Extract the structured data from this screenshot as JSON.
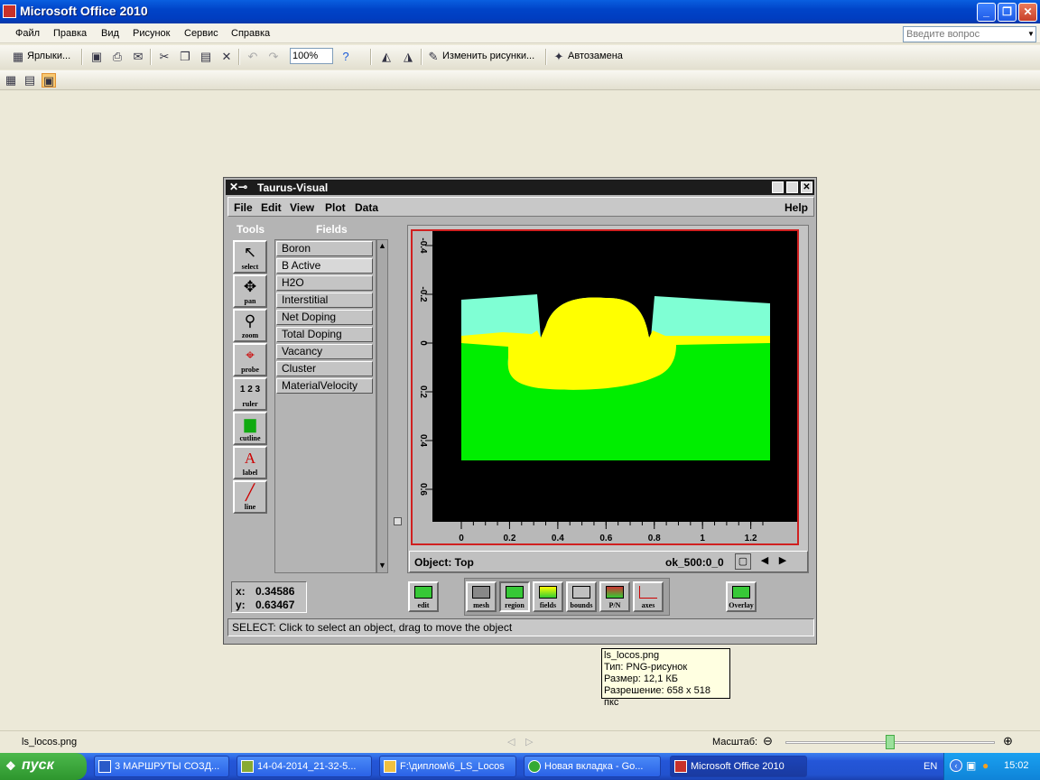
{
  "window": {
    "title": "Microsoft Office 2010"
  },
  "menu": [
    "Файл",
    "Правка",
    "Вид",
    "Рисунок",
    "Сервис",
    "Справка"
  ],
  "ask_placeholder": "Введите вопрос",
  "toolbar": {
    "shortcuts_label": "Ярлыки...",
    "zoom": "100%",
    "edit_pictures_label": "Изменить рисунки...",
    "autocorrect_label": "Автозамена"
  },
  "taurus": {
    "title": "Taurus-Visual",
    "menu": [
      "File",
      "Edit",
      "View",
      "Plot",
      "Data"
    ],
    "help": "Help",
    "tools_header": "Tools",
    "fields_header": "Fields",
    "tools": [
      "select",
      "pan",
      "zoom",
      "probe",
      "ruler",
      "cutline",
      "label",
      "line"
    ],
    "fields": [
      "Boron",
      "B Active",
      "H2O",
      "Interstitial",
      "Net Doping",
      "Total Doping",
      "Vacancy",
      "Cluster",
      "MaterialVelocity"
    ],
    "coords": {
      "x_label": "x:",
      "x": "0.34586",
      "y_label": "y:",
      "y": "0.63467"
    },
    "object_label": "Object: Top",
    "object_name": "ok_500:0_0",
    "bottom_buttons": [
      "edit",
      "mesh",
      "region",
      "fields",
      "bounds",
      "P/N",
      "axes",
      "Overlay"
    ],
    "status": "SELECT: Click to select an object, drag to move the object",
    "axes": {
      "x_ticks": [
        "0",
        "0.2",
        "0.4",
        "0.6",
        "0.8",
        "1",
        "1.2"
      ],
      "y_ticks": [
        "-0.4",
        "-0.2",
        "0",
        "0.2",
        "0.4",
        "0.6"
      ]
    },
    "colors": {
      "oxide": "#7fffd4",
      "silicon": "#00ee00",
      "poly": "#ffff00",
      "border": "#d02020"
    }
  },
  "tooltip": [
    "ls_locos.png",
    "Тип: PNG-рисунок",
    "Размер: 12,1 КБ",
    "Разрешение: 658 x 518 пкс"
  ],
  "statusbar": {
    "filename": "ls_locos.png",
    "zoom_label": "Масштаб:"
  },
  "taskbar": {
    "start": "пуск",
    "tasks": [
      "3 МАРШРУТЫ СОЗД...",
      "14-04-2014_21-32-5...",
      "F:\\диплом\\6_LS_Locos",
      "Новая вкладка - Go...",
      "Microsoft Office 2010"
    ],
    "lang": "EN",
    "clock": "15:02"
  }
}
